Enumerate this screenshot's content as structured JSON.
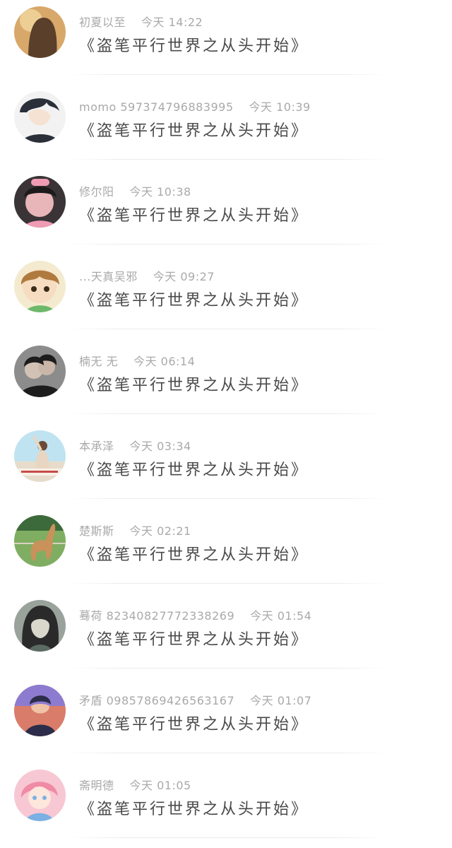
{
  "comments": [
    {
      "name": "初夏以至",
      "time": "今天 14:22",
      "text": "《盗笔平行世界之从头开始》",
      "avatar": {
        "bg": "#d8a86a",
        "fg": "#5a3f2a",
        "accent": "#f3d7a0",
        "icon": "user-avatar-icon"
      }
    },
    {
      "name": "momo 597374796883995",
      "time": "今天 10:39",
      "text": "《盗笔平行世界之从头开始》",
      "avatar": {
        "bg": "#f2f2f2",
        "fg": "#2b2f3a",
        "accent": "#f6e2d2",
        "icon": "user-avatar-icon"
      }
    },
    {
      "name": "修尔阳",
      "time": "今天 10:38",
      "text": "《盗笔平行世界之从头开始》",
      "avatar": {
        "bg": "#3a3436",
        "fg": "#e8b6b8",
        "accent": "#f09bb4",
        "icon": "user-avatar-icon"
      }
    },
    {
      "name": "...天真吴邪",
      "time": "今天 09:27",
      "text": "《盗笔平行世界之从头开始》",
      "avatar": {
        "bg": "#f4ead0",
        "fg": "#b07a3e",
        "accent": "#6db86a",
        "icon": "user-avatar-icon"
      }
    },
    {
      "name": "楠无 无",
      "time": "今天 06:14",
      "text": "《盗笔平行世界之从头开始》",
      "avatar": {
        "bg": "#8c8c8c",
        "fg": "#1d1d1d",
        "accent": "#d2c2b6",
        "icon": "user-avatar-icon"
      }
    },
    {
      "name": "本承泽",
      "time": "今天 03:34",
      "text": "《盗笔平行世界之从头开始》",
      "avatar": {
        "bg": "#bfe3f0",
        "fg": "#e9d6c2",
        "accent": "#c84a4a",
        "icon": "user-avatar-icon"
      }
    },
    {
      "name": "楚斯斯",
      "time": "今天 02:21",
      "text": "《盗笔平行世界之从头开始》",
      "avatar": {
        "bg": "#7fae62",
        "fg": "#c8925a",
        "accent": "#3d6a3a",
        "icon": "user-avatar-icon"
      }
    },
    {
      "name": "蓦荷 82340827772338269",
      "time": "今天 01:54",
      "text": "《盗笔平行世界之从头开始》",
      "avatar": {
        "bg": "#9aa29c",
        "fg": "#2a2a2a",
        "accent": "#d9d6cc",
        "icon": "user-avatar-icon"
      }
    },
    {
      "name": "矛盾 09857869426563167",
      "time": "今天 01:07",
      "text": "《盗笔平行世界之从头开始》",
      "avatar": {
        "bg": "#d97c6a",
        "fg": "#2c2d4a",
        "accent": "#8d7bd0",
        "icon": "user-avatar-icon"
      }
    },
    {
      "name": "斋明德",
      "time": "今天 01:05",
      "text": "《盗笔平行世界之从头开始》",
      "avatar": {
        "bg": "#f7c7d3",
        "fg": "#7ab0e3",
        "accent": "#f08aa5",
        "icon": "user-avatar-icon"
      }
    }
  ]
}
